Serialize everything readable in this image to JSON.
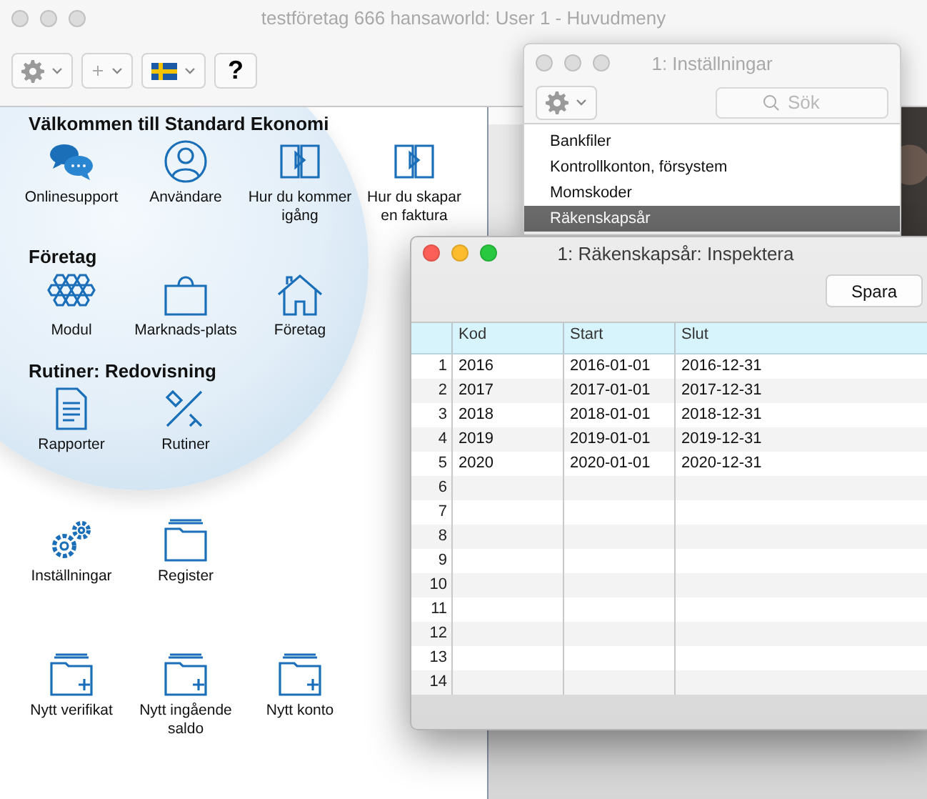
{
  "main_window": {
    "title": "testföretag 666 hansaworld: User 1 - Huvudmeny",
    "toolbar": [
      {
        "kind": "gear"
      },
      {
        "kind": "plus"
      },
      {
        "kind": "flag"
      },
      {
        "kind": "help",
        "label": "?"
      }
    ],
    "sections": [
      {
        "title": "Välkommen till Standard Ekonomi",
        "items": [
          {
            "label": "Onlinesupport",
            "kind": "chat"
          },
          {
            "label": "Användare",
            "kind": "user"
          },
          {
            "label": "Hur du kommer igång",
            "kind": "book"
          },
          {
            "label": "Hur du skapar en faktura",
            "kind": "book"
          }
        ]
      },
      {
        "title": "Företag",
        "items": [
          {
            "label": "Modul",
            "kind": "hex"
          },
          {
            "label": "Marknads-plats",
            "kind": "bag"
          },
          {
            "label": "Företag",
            "kind": "house"
          }
        ]
      },
      {
        "title": "Rutiner: Redovisning",
        "items": [
          {
            "label": "Rapporter",
            "kind": "doc"
          },
          {
            "label": "Rutiner",
            "kind": "tools"
          }
        ]
      },
      {
        "items": [
          {
            "label": "Inställningar",
            "kind": "gears"
          },
          {
            "label": "Register",
            "kind": "folder"
          }
        ]
      },
      {
        "items": [
          {
            "label": "Nytt verifikat",
            "kind": "newfolder"
          },
          {
            "label": "Nytt ingående saldo",
            "kind": "newfolder"
          },
          {
            "label": "Nytt konto",
            "kind": "newfolder"
          }
        ]
      }
    ]
  },
  "settings_window": {
    "title": "1: Inställningar",
    "search": {
      "placeholder": "Sök"
    },
    "items": [
      {
        "label": "Bankfiler",
        "selected": false
      },
      {
        "label": "Kontrollkonton, försystem",
        "selected": false
      },
      {
        "label": "Momskoder",
        "selected": false
      },
      {
        "label": "Räkenskapsår",
        "selected": true
      }
    ]
  },
  "inspect_window": {
    "title": "1: Räkenskapsår: Inspektera",
    "save_button": "Spara",
    "columns": [
      "Kod",
      "Start",
      "Slut"
    ],
    "rows": [
      {
        "number": "1",
        "cells": [
          "2016",
          "2016-01-01",
          "2016-12-31"
        ]
      },
      {
        "number": "2",
        "cells": [
          "2017",
          "2017-01-01",
          "2017-12-31"
        ]
      },
      {
        "number": "3",
        "cells": [
          "2018",
          "2018-01-01",
          "2018-12-31"
        ]
      },
      {
        "number": "4",
        "cells": [
          "2019",
          "2019-01-01",
          "2019-12-31"
        ]
      },
      {
        "number": "5",
        "cells": [
          "2020",
          "2020-01-01",
          "2020-12-31"
        ]
      },
      {
        "number": "6"
      },
      {
        "number": "7"
      },
      {
        "number": "8"
      },
      {
        "number": "9"
      },
      {
        "number": "10"
      },
      {
        "number": "11"
      },
      {
        "number": "12"
      },
      {
        "number": "13"
      },
      {
        "number": "14"
      }
    ]
  }
}
